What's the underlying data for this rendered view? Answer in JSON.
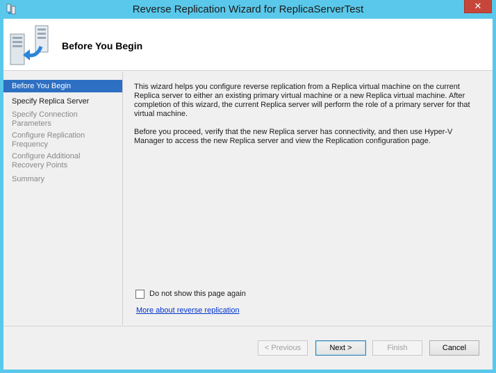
{
  "window": {
    "title": "Reverse Replication Wizard for ReplicaServerTest",
    "close_label": "✕"
  },
  "header": {
    "title": "Before You Begin"
  },
  "nav": {
    "items": [
      {
        "label": "Before You Begin",
        "state": "active"
      },
      {
        "label": "Specify Replica Server",
        "state": "next"
      },
      {
        "label": "Specify Connection Parameters",
        "state": "disabled"
      },
      {
        "label": "Configure Replication Frequency",
        "state": "disabled"
      },
      {
        "label": "Configure Additional Recovery Points",
        "state": "disabled"
      },
      {
        "label": "Summary",
        "state": "disabled"
      }
    ]
  },
  "content": {
    "paragraph1": "This wizard helps you configure reverse replication from a Replica virtual machine on the current Replica server to either an existing primary virtual machine or a new Replica virtual machine. After completion of this wizard, the current Replica server will perform the role of a primary server for that virtual machine.",
    "paragraph2": "Before you proceed, verify that the new Replica server has connectivity, and then use Hyper-V Manager to access the new Replica server and view the Replication configuration page."
  },
  "options": {
    "do_not_show_label": "Do not show this page again",
    "do_not_show_checked": false,
    "more_link": "More about reverse replication"
  },
  "buttons": {
    "previous": "< Previous",
    "next": "Next >",
    "finish": "Finish",
    "cancel": "Cancel"
  },
  "colors": {
    "title_bar": "#5ac8ea",
    "nav_selected": "#2d6fc2",
    "close_button": "#c7463a",
    "link": "#0033cc"
  }
}
